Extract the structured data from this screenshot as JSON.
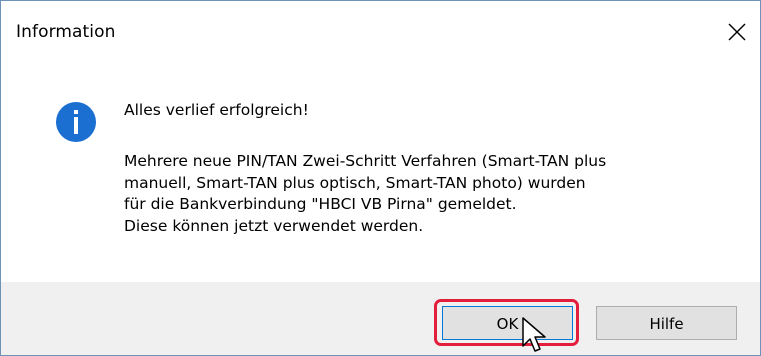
{
  "window": {
    "title": "Information",
    "close_icon": "close-icon"
  },
  "message": {
    "icon": "info-icon",
    "heading": "Alles verlief erfolgreich!",
    "lines": [
      "Mehrere neue PIN/TAN Zwei-Schritt Verfahren (Smart-TAN plus",
      "manuell, Smart-TAN plus optisch, Smart-TAN photo) wurden",
      "für die Bankverbindung \"HBCI VB Pirna\" gemeldet.",
      "Diese können jetzt verwendet werden."
    ]
  },
  "buttons": {
    "ok_label": "OK",
    "help_label": "Hilfe"
  },
  "colors": {
    "info_icon": "#1a6fd1",
    "highlight": "#e31d3c",
    "footer_bg": "#f0f0f0"
  }
}
